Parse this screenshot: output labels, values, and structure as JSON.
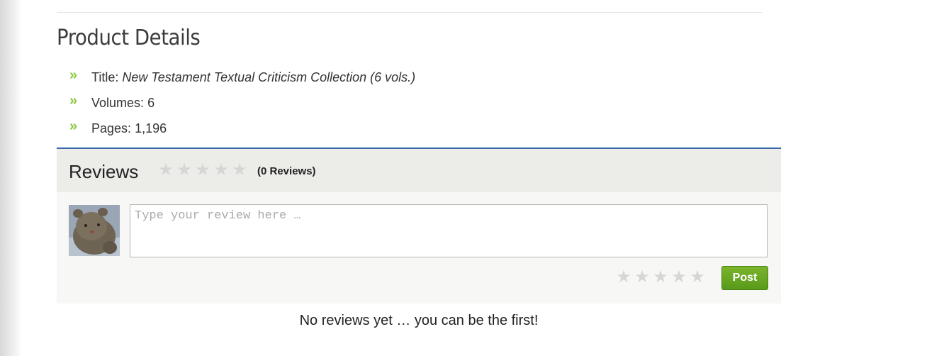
{
  "product_details": {
    "heading": "Product Details",
    "items": [
      {
        "label": "Title:",
        "value": "New Testament Textual Criticism Collection (6 vols.)"
      },
      {
        "label": "Volumes:",
        "value": "6"
      },
      {
        "label": "Pages:",
        "value": "1,196"
      }
    ],
    "bullet_glyph": "»",
    "bullet_color": "#8cc43f"
  },
  "reviews": {
    "heading": "Reviews",
    "rating_stars": 0,
    "max_stars": 5,
    "count_text": "(0 Reviews)",
    "accent_color": "#3a67a8",
    "form": {
      "placeholder": "Type your review here …",
      "value": "",
      "user_rating_stars": 0,
      "post_label": "Post",
      "post_color": "#6aa823"
    },
    "empty_message": "No reviews yet … you can be the first!"
  }
}
